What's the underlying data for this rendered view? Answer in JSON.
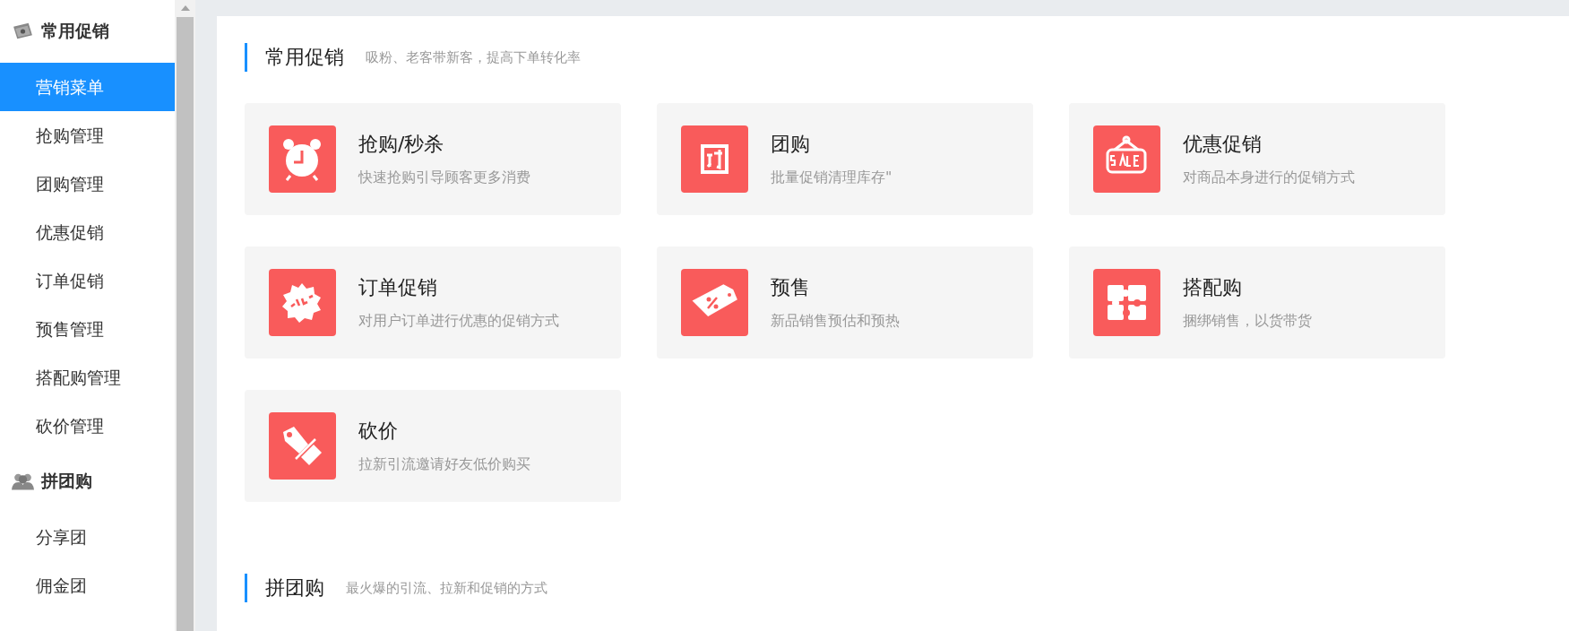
{
  "sidebar": {
    "groups": [
      {
        "title": "常用促销",
        "kind": "coupon",
        "items": [
          {
            "label": "营销菜单",
            "selected": true
          },
          {
            "label": "抢购管理",
            "selected": false
          },
          {
            "label": "团购管理",
            "selected": false
          },
          {
            "label": "优惠促销",
            "selected": false
          },
          {
            "label": "订单促销",
            "selected": false
          },
          {
            "label": "预售管理",
            "selected": false
          },
          {
            "label": "搭配购管理",
            "selected": false
          },
          {
            "label": "砍价管理",
            "selected": false
          }
        ]
      },
      {
        "title": "拼团购",
        "kind": "people",
        "items": [
          {
            "label": "分享团",
            "selected": false
          },
          {
            "label": "佣金团",
            "selected": false
          }
        ]
      }
    ]
  },
  "sections": [
    {
      "title": "常用促销",
      "subtitle": "吸粉、老客带新客，提高下单转化率",
      "cards": [
        {
          "kind": "clock",
          "title": "抢购/秒杀",
          "description": "快速抢购引导顾客更多消费"
        },
        {
          "kind": "tuan",
          "title": "团购",
          "description": "批量促销清理库存\""
        },
        {
          "kind": "sale-sign",
          "title": "优惠促销",
          "description": "对商品本身进行的促销方式"
        },
        {
          "kind": "sale-badge",
          "title": "订单促销",
          "description": "对用户订单进行优惠的促销方式"
        },
        {
          "kind": "percent-tag",
          "title": "预售",
          "description": "新品销售预估和预热"
        },
        {
          "kind": "puzzle",
          "title": "搭配购",
          "description": "捆绑销售，以货带货"
        },
        {
          "kind": "cut-tag",
          "title": "砍价",
          "description": "拉新引流邀请好友低价购买"
        }
      ]
    },
    {
      "title": "拼团购",
      "subtitle": "最火爆的引流、拉新和促销的方式"
    }
  ]
}
